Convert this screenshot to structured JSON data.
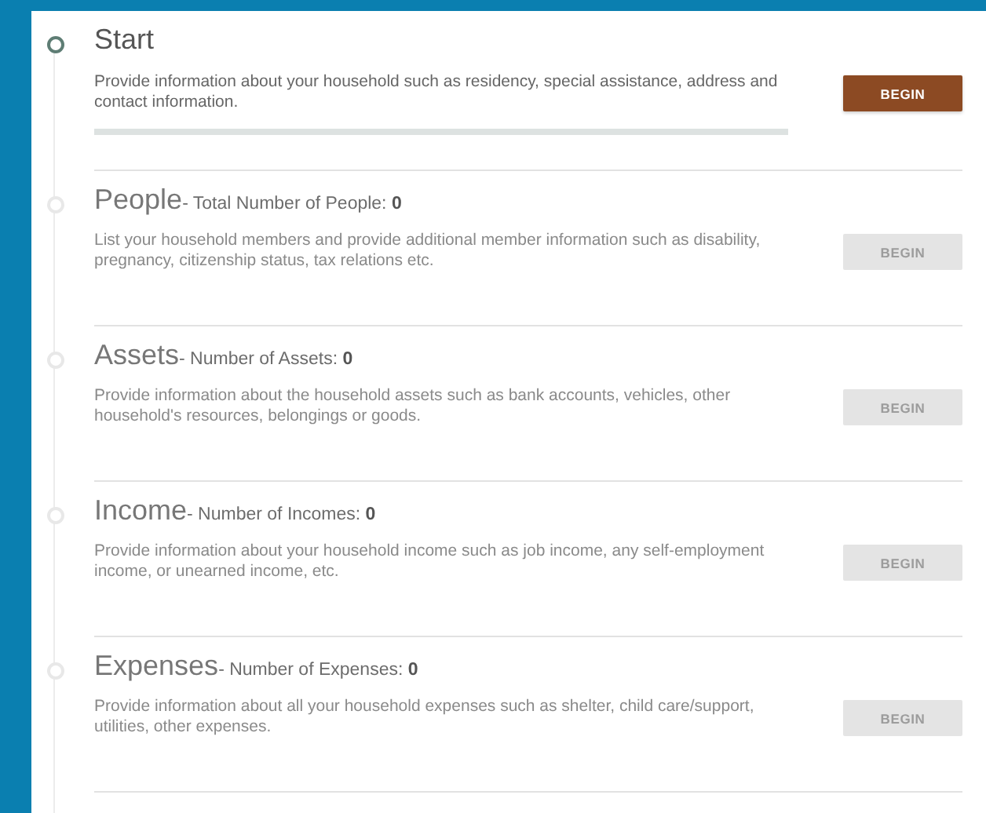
{
  "steps": [
    {
      "title": "Start",
      "description": "Provide information about your household such as residency, special assistance, address and contact information.",
      "button": "BEGIN",
      "active": true
    },
    {
      "title": "People",
      "subtitle": "- Total Number of People: ",
      "count": "0",
      "description": "List your household members and provide additional member information such as disability, pregnancy, citizenship status, tax relations etc.",
      "button": "BEGIN",
      "active": false
    },
    {
      "title": "Assets",
      "subtitle": "- Number of Assets: ",
      "count": "0",
      "description": "Provide information about the household assets such as bank accounts, vehicles, other household's resources, belongings or goods.",
      "button": "BEGIN",
      "active": false
    },
    {
      "title": "Income",
      "subtitle": "- Number of Incomes: ",
      "count": "0",
      "description": "Provide information about your household income such as job income, any self-employment income, or unearned income, etc.",
      "button": "BEGIN",
      "active": false
    },
    {
      "title": "Expenses",
      "subtitle": "- Number of Expenses: ",
      "count": "0",
      "description": "Provide information about all your household expenses such as shelter, child care/support, utilities, other expenses.",
      "button": "BEGIN",
      "active": false
    }
  ]
}
